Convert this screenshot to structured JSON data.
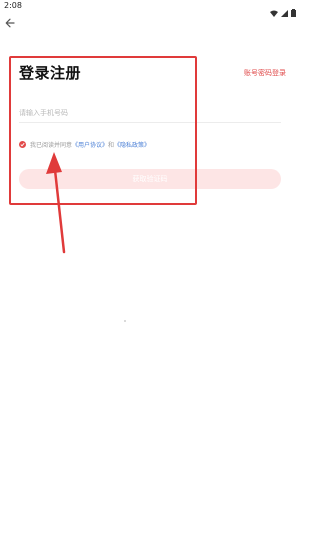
{
  "status_bar": {
    "time": "2:08",
    "icons": [
      "wifi-icon",
      "signal-icon",
      "battery-icon"
    ]
  },
  "header": {
    "back_icon": "arrow-left-icon"
  },
  "main": {
    "title": "登录注册",
    "password_login_link": "账号密码登录",
    "phone_placeholder": "请输入手机号码",
    "agreement": {
      "checked": true,
      "prefix": "我已阅读并同意",
      "user_agreement": "《用户协议》",
      "joiner": "和",
      "privacy_policy": "《隐私政策》"
    },
    "login_button": "获取验证码"
  },
  "colors": {
    "accent": "#e24b4b",
    "button_disabled": "#fde5e5",
    "link": "#4a7fd6",
    "annotation": "#e03a3a"
  }
}
